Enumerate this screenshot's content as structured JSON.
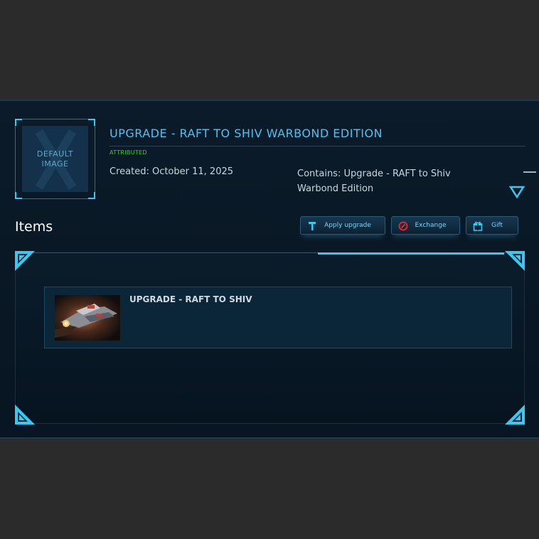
{
  "pledge": {
    "thumbnail_label_line1": "DEFAULT",
    "thumbnail_label_line2": "IMAGE",
    "title": "UPGRADE - RAFT TO SHIV WARBOND EDITION",
    "status": "ATTRIBUTED",
    "created": "Created: October 11, 2025",
    "contains": "Contains: Upgrade - RAFT to Shiv Warbond Edition"
  },
  "items_section": {
    "heading": "Items",
    "buttons": [
      {
        "label": "Apply upgrade",
        "icon": "hammer-icon"
      },
      {
        "label": "Exchange",
        "icon": "exchange-icon"
      },
      {
        "label": "Gift",
        "icon": "gift-icon"
      }
    ],
    "items": [
      {
        "name": "UPGRADE - RAFT TO SHIV"
      }
    ]
  },
  "colors": {
    "accent": "#4fc2ef",
    "status_green": "#2fd32f",
    "background": "#2b2b2c",
    "panel": "#0b1b29"
  }
}
